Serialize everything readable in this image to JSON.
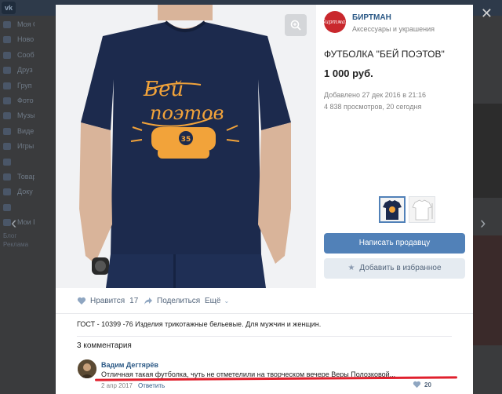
{
  "background": {
    "sidebar_items": [
      "Моя С",
      "Ново",
      "Сооб",
      "Друз",
      "Груп",
      "Фото",
      "Музы",
      "Виде",
      "Игры",
      "",
      "Товар",
      "Доку",
      "",
      "Мои Г"
    ],
    "side_footer": "Блог\nРеклама"
  },
  "photo": {
    "print_text": [
      "Бей",
      "поэтов"
    ],
    "knuckle_number": "35",
    "colors": {
      "shirt": "#1c2a4d",
      "print": "#f2a33a",
      "background": "#f1f2f4"
    }
  },
  "seller": {
    "avatar_text": "Биртман",
    "name": "БИРТМАН",
    "subtitle": "Аксессуары и украшения"
  },
  "product": {
    "title": "ФУТБОЛКА \"БЕЙ ПОЭТОВ\"",
    "price": "1 000 руб.",
    "added": "Добавлено 27 дек 2016 в 21:16",
    "views": "4 838 просмотров, 20 сегодня"
  },
  "buttons": {
    "write_seller": "Написать продавцу",
    "add_favorite": "Добавить в избранное"
  },
  "actions": {
    "like_label": "Нравится",
    "like_count": "17",
    "share_label": "Поделиться",
    "more_label": "Ещё"
  },
  "description": "ГОСТ - 10399 -76 Изделия трикотажные бельевые. Для мужчин и женщин.",
  "comments": {
    "count_label": "3 комментария",
    "items": [
      {
        "author": "Вадим Дегтярёв",
        "text": "Отличная такая футболка, чуть не отметелили на творческом вечере Веры Полозковой...",
        "date": "2 апр 2017",
        "reply": "Ответить",
        "likes": "20"
      }
    ]
  },
  "colors": {
    "accent": "#5181b8",
    "link": "#2a5885",
    "highlight_underline": "#e0202d"
  }
}
